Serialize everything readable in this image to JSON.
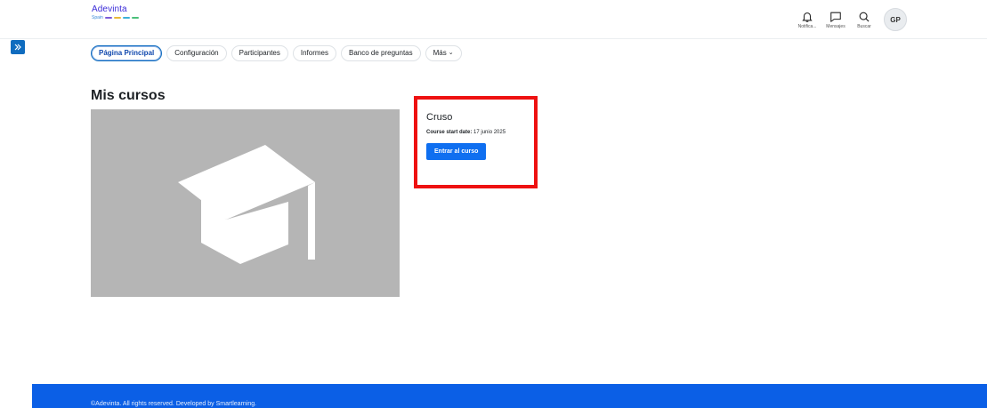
{
  "brand": {
    "name": "Adevinta",
    "sub": "Spain",
    "stripe_colors": [
      "#7c5cd8",
      "#e8b93a",
      "#3ab0d8",
      "#4bc07a"
    ]
  },
  "header": {
    "actions": [
      {
        "label": "Notifica...",
        "icon": "bell-icon"
      },
      {
        "label": "Mensajes",
        "icon": "chat-icon"
      },
      {
        "label": "Buscar",
        "icon": "search-icon"
      }
    ],
    "avatar_initials": "GP"
  },
  "secondary_nav": {
    "items": [
      {
        "label": "Página Principal",
        "active": true
      },
      {
        "label": "Configuración",
        "active": false
      },
      {
        "label": "Participantes",
        "active": false
      },
      {
        "label": "Informes",
        "active": false
      },
      {
        "label": "Banco de preguntas",
        "active": false
      },
      {
        "label": "Más",
        "active": false
      }
    ]
  },
  "main": {
    "heading": "Mis cursos",
    "course": {
      "title": "Cruso",
      "start_label": "Course start date:",
      "start_value": "17 junio 2025",
      "enter_button": "Entrar al curso",
      "image_icon": "graduation-cap-icon"
    }
  },
  "footer": {
    "text": "©Adevinta. All rights reserved. Developed by Smartlearning."
  },
  "colors": {
    "accent": "#0f6cbf",
    "button": "#0f6ff0",
    "footer": "#0b5fe6",
    "highlight_border": "#ee1111"
  }
}
